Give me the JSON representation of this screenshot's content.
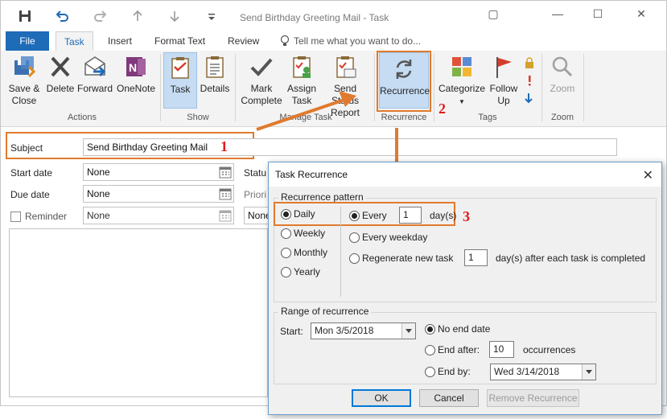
{
  "window": {
    "title": "Send Birthday Greeting Mail - Task",
    "controls": {
      "restore": "▢",
      "minimize": "—",
      "maximize": "☐",
      "close": "✕"
    }
  },
  "tabs": {
    "file": "File",
    "task": "Task",
    "insert": "Insert",
    "format_text": "Format Text",
    "review": "Review",
    "tell_me": "Tell me what you want to do..."
  },
  "ribbon": {
    "actions": {
      "save_close": [
        "Save &",
        "Close"
      ],
      "delete": "Delete",
      "forward": "Forward",
      "onenote": "OneNote",
      "group": "Actions"
    },
    "show": {
      "task": "Task",
      "details": "Details",
      "group": "Show"
    },
    "manage": {
      "mark_complete": [
        "Mark",
        "Complete"
      ],
      "assign_task": [
        "Assign",
        "Task"
      ],
      "send_status": [
        "Send Status",
        "Report"
      ],
      "group": "Manage Task"
    },
    "recurrence": {
      "recurrence": "Recurrence",
      "group": "Recurrence"
    },
    "tags": {
      "categorize": "Categorize",
      "follow_up": [
        "Follow",
        "Up"
      ],
      "group": "Tags"
    },
    "zoom": {
      "zoom": "Zoom",
      "group": "Zoom"
    }
  },
  "form": {
    "subject_label": "Subject",
    "subject_value": "Send Birthday Greeting Mail",
    "start_date_label": "Start date",
    "start_date_value": "None",
    "due_date_label": "Due date",
    "due_date_value": "None",
    "reminder_label": "Reminder",
    "reminder_value": "None",
    "status_label": "Statu",
    "priority_label": "Priori",
    "right_value": "None"
  },
  "dialog": {
    "title": "Task Recurrence",
    "pattern_legend": "Recurrence pattern",
    "patterns": [
      "Daily",
      "Weekly",
      "Monthly",
      "Yearly"
    ],
    "selected_pattern": "Daily",
    "every_label": "Every",
    "every_value": "1",
    "days_label": "day(s)",
    "every_weekday": "Every weekday",
    "regenerate_label": "Regenerate new task",
    "regenerate_value": "1",
    "regenerate_suffix": "day(s) after each task is completed",
    "range_legend": "Range of recurrence",
    "start_label": "Start:",
    "start_value": "Mon 3/5/2018",
    "no_end_date": "No end date",
    "end_after": "End after:",
    "end_after_value": "10",
    "occurrences": "occurrences",
    "end_by": "End by:",
    "end_by_value": "Wed 3/14/2018",
    "ok": "OK",
    "cancel": "Cancel",
    "remove": "Remove Recurrence"
  },
  "steps": {
    "one": "1",
    "two": "2",
    "three": "3"
  },
  "colors": {
    "accent": "#1e6bb8",
    "annotation": "#e07a2e",
    "step_text": "#e01b1b",
    "highlight": "#c5dcf2"
  },
  "icons": [
    "save-icon",
    "undo-icon",
    "redo-icon",
    "up-arrow-icon",
    "down-arrow-icon",
    "customize-icon",
    "lightbulb-icon",
    "save-close-icon",
    "delete-icon",
    "forward-icon",
    "onenote-icon",
    "task-icon",
    "details-icon",
    "checkmark-icon",
    "assign-task-icon",
    "send-status-icon",
    "recurrence-icon",
    "categorize-icon",
    "follow-up-flag-icon",
    "private-lock-icon",
    "high-importance-icon",
    "low-importance-icon",
    "zoom-icon",
    "calendar-icon",
    "close-icon"
  ]
}
